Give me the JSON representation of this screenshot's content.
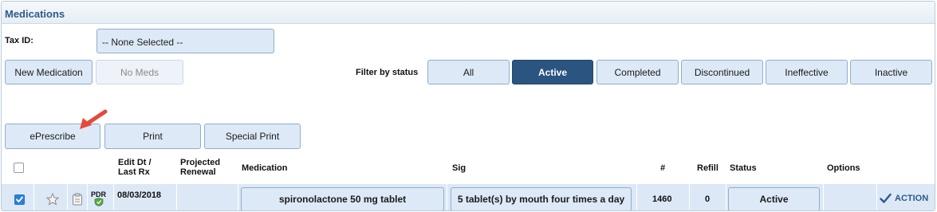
{
  "panel": {
    "title": "Medications"
  },
  "tax": {
    "label": "Tax ID:",
    "value": "-- None Selected --"
  },
  "buttons": {
    "new_medication": "New Medication",
    "no_meds": "No Meds",
    "eprescribe": "ePrescribe",
    "print": "Print",
    "special_print": "Special Print"
  },
  "filter": {
    "label": "Filter by status",
    "options": [
      "All",
      "Active",
      "Completed",
      "Discontinued",
      "Ineffective",
      "Inactive"
    ],
    "selected": "Active"
  },
  "table": {
    "headers": {
      "edit_dt_1": "Edit Dt /",
      "edit_dt_2": "Last Rx",
      "proj_1": "Projected",
      "proj_2": "Renewal",
      "medication": "Medication",
      "sig": "Sig",
      "count": "#",
      "refill": "Refill",
      "status": "Status",
      "options": "Options"
    },
    "rows": [
      {
        "checked": true,
        "pdr": "PDR",
        "edit_date": "08/03/2018",
        "projected_renewal": "",
        "medication": "spironolactone 50 mg tablet",
        "sig": "5 tablet(s) by mouth four times a day",
        "count": "1460",
        "refill": "0",
        "status": "Active",
        "action": "ACTION"
      }
    ]
  },
  "colors": {
    "accent": "#2c5480",
    "title": "#2d5a88",
    "button_bg": "#dde9f6",
    "row_bg": "#dce8f5",
    "arrow": "#e5493a"
  }
}
